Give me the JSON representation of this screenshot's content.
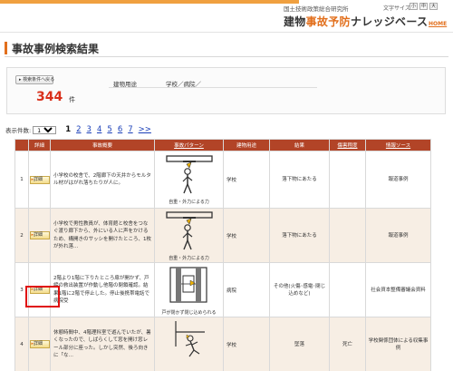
{
  "header": {
    "org": "国土技術政策総合研究所",
    "font_size_label": "文字サイズ",
    "font_size_buttons": [
      "小",
      "中",
      "大"
    ],
    "title_part1": "建物",
    "title_highlight": "事故予防",
    "title_part2": "ナレッジベース",
    "home_link": "HOME"
  },
  "page": {
    "heading": "事故事例検索結果"
  },
  "conditions": {
    "back_button": "検索条件へ戻る",
    "count": "344",
    "count_unit": "件",
    "label": "建物用途",
    "value": "学校／病院／"
  },
  "paging": {
    "per_page_label": "表示件数:",
    "per_page_value": "10件",
    "current_page": "1",
    "pages": [
      "2",
      "3",
      "4",
      "5",
      "6",
      "7",
      ">>"
    ]
  },
  "table": {
    "headers": [
      "詳細",
      "事故概要",
      "事故パターン",
      "建物用途",
      "結果",
      "傷害程度",
      "情報ソース"
    ],
    "detail_label": "詳細",
    "rows": [
      {
        "num": "1",
        "summary": "小学校の校舎で、2階廊下の天井からモルタル材がはがれ落ちたりが人に。",
        "pattern_caption": "自重・外力による力",
        "use": "学校",
        "result": "落下物にあたる",
        "severity": "",
        "source": "報道事例"
      },
      {
        "num": "2",
        "summary": "小学校で男性教員が、体育館と校舎をつなぐ渡り廊下から、外にいる人に声をかけるため、構開きのサッシを開けたところ、1枚が外れ落...",
        "pattern_caption": "自重・外力による力",
        "use": "学校",
        "result": "落下物にあたる",
        "severity": "",
        "source": "報道事例"
      },
      {
        "num": "3",
        "summary": "2階より1階に下りたところ扉が開かず、戸締の救出装置が作動し他階の閉鎖確認。結果1階に2階で停止した。停止後携帯電話で病院受",
        "pattern_caption": "戸が閉かず閉じ込められる",
        "use": "病院",
        "result": "その他(火傷･感電･閉じ込めなど)",
        "severity": "",
        "source": "社会資本整備審議会資料"
      },
      {
        "num": "4",
        "summary": "休憩時間中、4階理科室で遊んでいたが、暑くなったので、しばらくして窓を開け窓レール部分に座った。しかし突然、後ろ向きに「な…",
        "pattern_caption": "",
        "use": "学校",
        "result": "墜落",
        "severity": "死亡",
        "source": "学校関係団体による収集事例"
      }
    ]
  }
}
